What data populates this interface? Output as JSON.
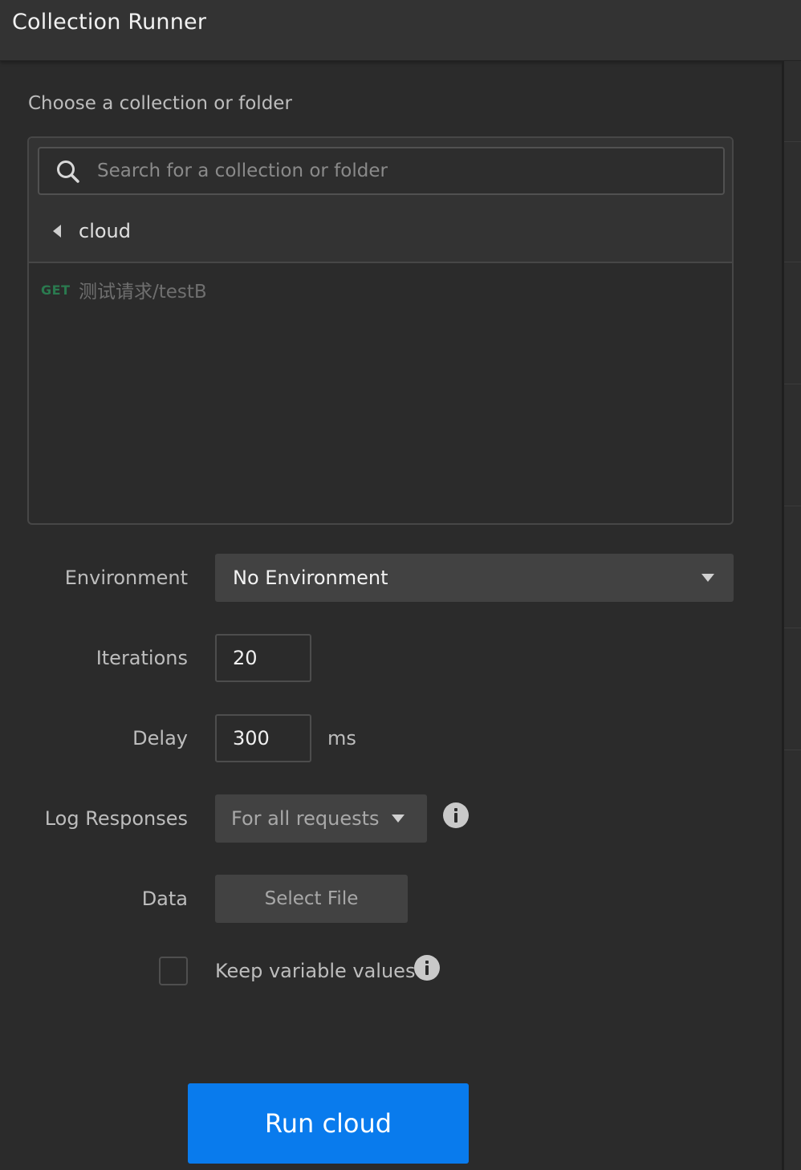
{
  "window": {
    "title": "Collection Runner"
  },
  "collection_picker": {
    "label": "Choose a collection or folder",
    "search_placeholder": "Search for a collection or folder",
    "breadcrumb": "cloud",
    "requests": [
      {
        "method": "GET",
        "name": "测试请求/testB"
      }
    ]
  },
  "form": {
    "environment": {
      "label": "Environment",
      "value": "No Environment"
    },
    "iterations": {
      "label": "Iterations",
      "value": "20"
    },
    "delay": {
      "label": "Delay",
      "value": "300",
      "unit": "ms"
    },
    "log_responses": {
      "label": "Log Responses",
      "value": "For all requests"
    },
    "data": {
      "label": "Data",
      "button": "Select File"
    },
    "keep_variables": {
      "label": "Keep variable values",
      "checked": false
    }
  },
  "run_button": {
    "label": "Run cloud",
    "color": "#097bed"
  },
  "icons": [
    "search-icon",
    "caret-left-icon",
    "chevron-down-icon",
    "info-icon"
  ]
}
